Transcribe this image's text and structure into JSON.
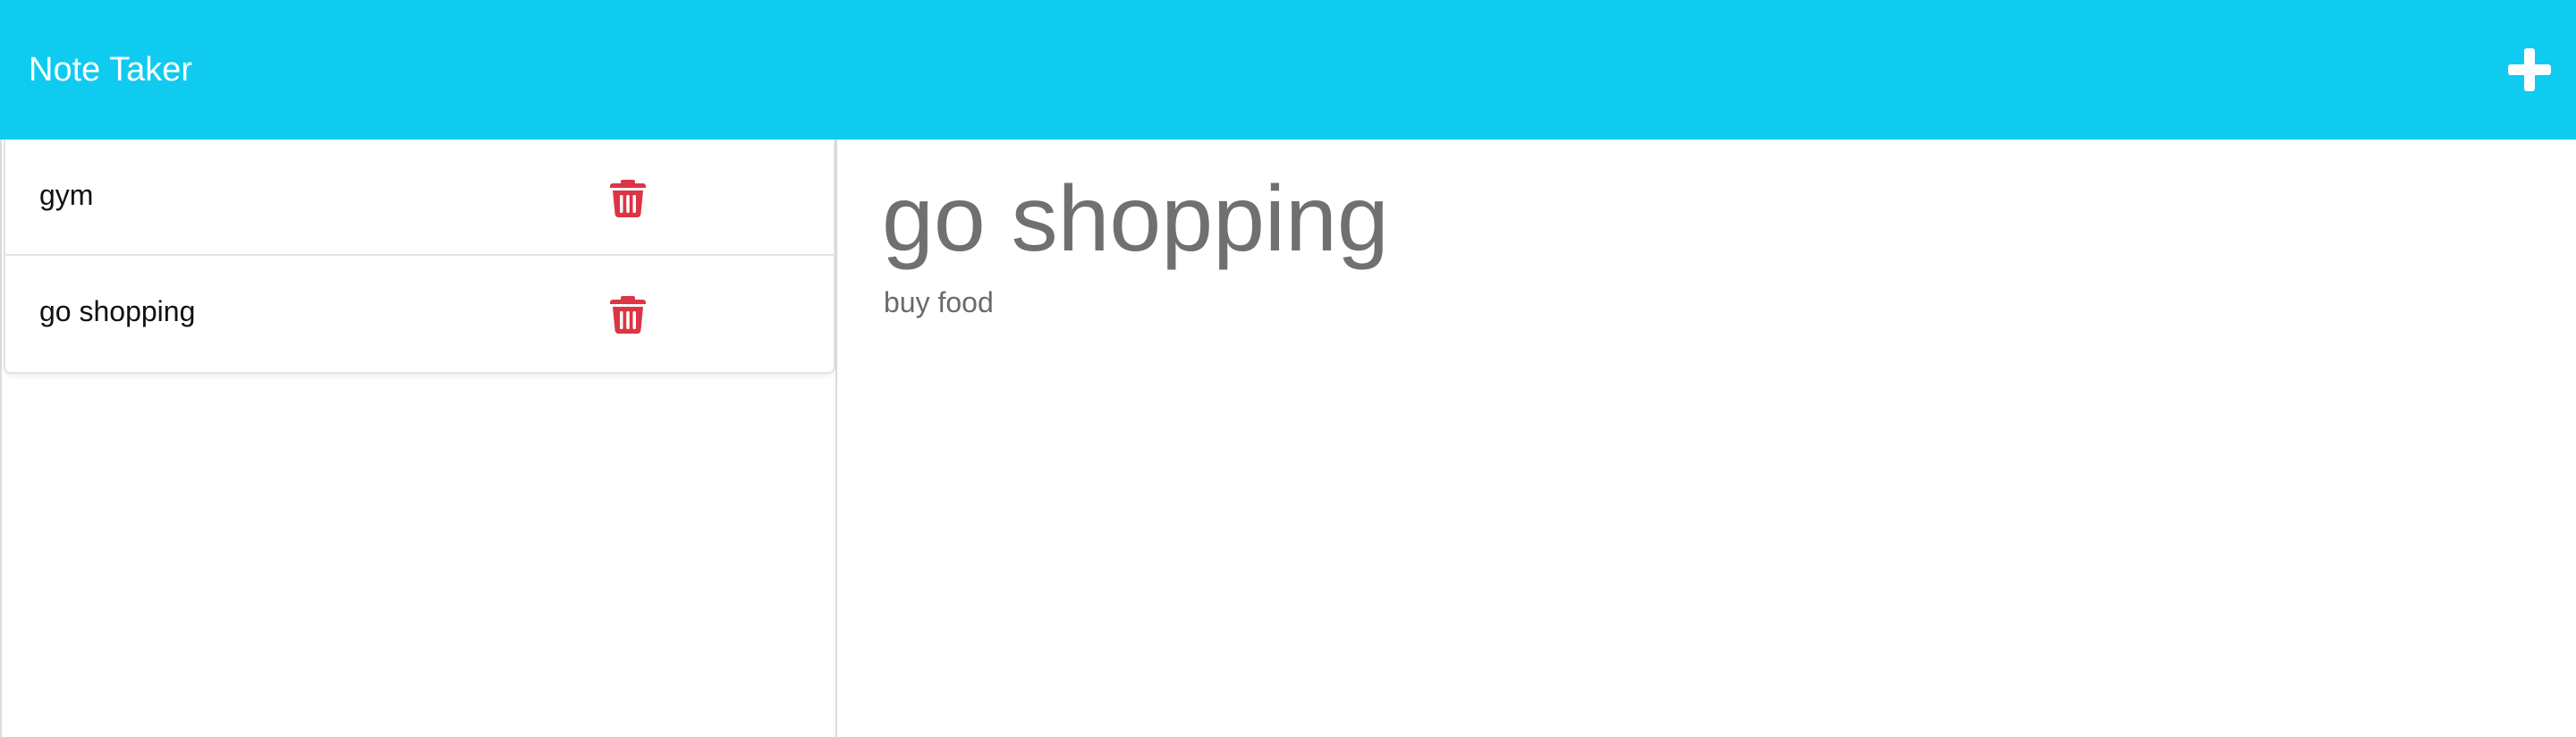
{
  "app": {
    "title": "Note Taker",
    "new_note_icon": "plus-icon",
    "accent_color": "#0fcbef",
    "delete_color": "#dc3545"
  },
  "notes": [
    {
      "title": "gym",
      "delete_icon": "trash-icon"
    },
    {
      "title": "go shopping",
      "delete_icon": "trash-icon"
    }
  ],
  "active_note": {
    "title": "go shopping",
    "text": "buy food"
  }
}
